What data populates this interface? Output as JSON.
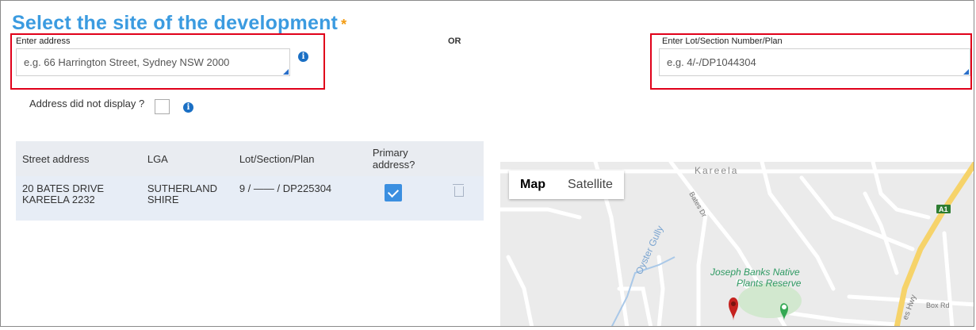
{
  "page": {
    "title": "Select the site of the development",
    "required_mark": "*",
    "or_label": "OR"
  },
  "address": {
    "label": "Enter address",
    "placeholder": "e.g. 66 Harrington Street, Sydney NSW 2000"
  },
  "lot": {
    "label": "Enter Lot/Section Number/Plan",
    "placeholder": "e.g. 4/-/DP1044304"
  },
  "address_not_displayed": {
    "label": "Address did not display ?"
  },
  "table": {
    "headers": [
      "Street address",
      "LGA",
      "Lot/Section/Plan",
      "Primary address?"
    ],
    "rows": [
      {
        "street_line1": "20 BATES DRIVE",
        "street_line2": "KAREELA 2232",
        "lga_line1": "SUTHERLAND",
        "lga_line2": "SHIRE",
        "lot": "9 / —— / DP225304",
        "primary": true
      }
    ]
  },
  "map": {
    "buttons": [
      "Map",
      "Satellite"
    ],
    "active": "Map",
    "labels": {
      "suburb": "Kareela",
      "park_line1": "Joseph Banks Native",
      "park_line2": "Plants Reserve",
      "creek": "Oyster Gully",
      "road_a": "Bates Dr",
      "road_b": "Box Rd",
      "shield": "A1",
      "hwy": "es Hwy"
    }
  }
}
